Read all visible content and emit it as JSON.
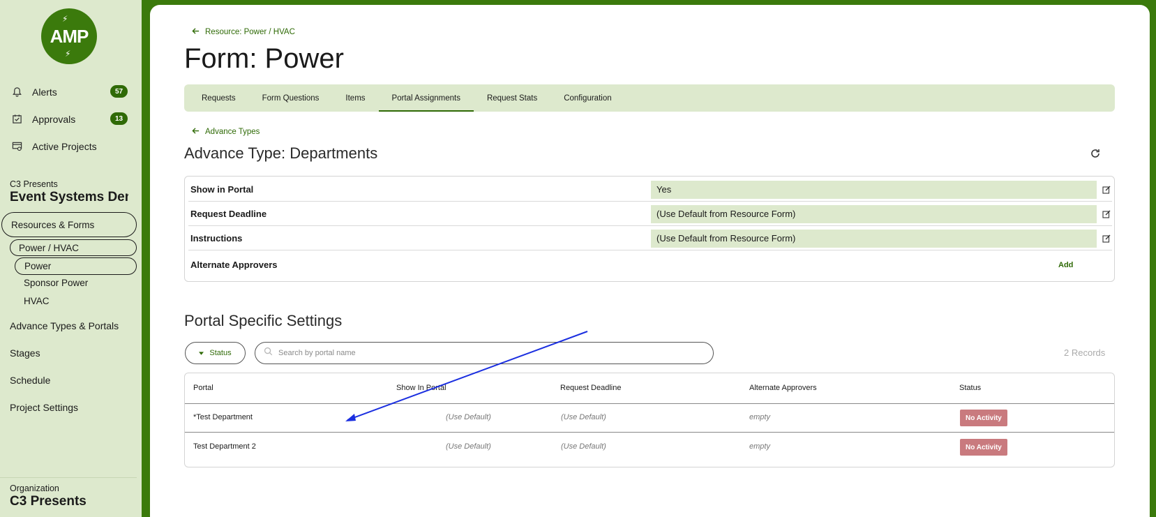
{
  "app": {
    "logo_text": "AMP",
    "accent_color": "#3b7a0c"
  },
  "sidebar": {
    "nav": [
      {
        "label": "Alerts",
        "icon": "bell-icon",
        "badge": "57"
      },
      {
        "label": "Approvals",
        "icon": "checkbox-icon",
        "badge": "13"
      },
      {
        "label": "Active Projects",
        "icon": "projects-icon"
      }
    ],
    "project_org": "C3 Presents",
    "project_name": "Event Systems Demo",
    "resources_label": "Resources & Forms",
    "power_hvac_label": "Power / HVAC",
    "power_label": "Power",
    "sponsor_power_label": "Sponsor Power",
    "hvac_label": "HVAC",
    "advance_types_label": "Advance Types & Portals",
    "stages_label": "Stages",
    "schedule_label": "Schedule",
    "project_settings_label": "Project Settings",
    "org_label": "Organization",
    "org_name": "C3 Presents"
  },
  "main": {
    "breadcrumb": "Resource: Power / HVAC",
    "title": "Form: Power",
    "tabs": [
      "Requests",
      "Form Questions",
      "Items",
      "Portal Assignments",
      "Request Stats",
      "Configuration"
    ],
    "active_tab": "Portal Assignments",
    "back_link": "Advance Types",
    "section_title": "Advance Type: Departments",
    "settings": {
      "show_in_portal_label": "Show in Portal",
      "show_in_portal_value": "Yes",
      "request_deadline_label": "Request Deadline",
      "request_deadline_value": "(Use Default from Resource Form)",
      "instructions_label": "Instructions",
      "instructions_value": "(Use Default from Resource Form)",
      "alternate_approvers_label": "Alternate Approvers",
      "add_label": "Add"
    },
    "portal_section_title": "Portal Specific Settings",
    "status_filter_label": "Status",
    "search_placeholder": "Search by portal name",
    "records_count": "2 Records",
    "table": {
      "headers": [
        "Portal",
        "Show In Portal",
        "Request Deadline",
        "Alternate Approvers",
        "Status"
      ],
      "rows": [
        {
          "portal": "*Test Department",
          "show": "(Use Default)",
          "deadline": "(Use Default)",
          "approvers": "empty",
          "status": "No Activity"
        },
        {
          "portal": "Test Department 2",
          "show": "(Use Default)",
          "deadline": "(Use Default)",
          "approvers": "empty",
          "status": "No Activity"
        }
      ]
    }
  }
}
